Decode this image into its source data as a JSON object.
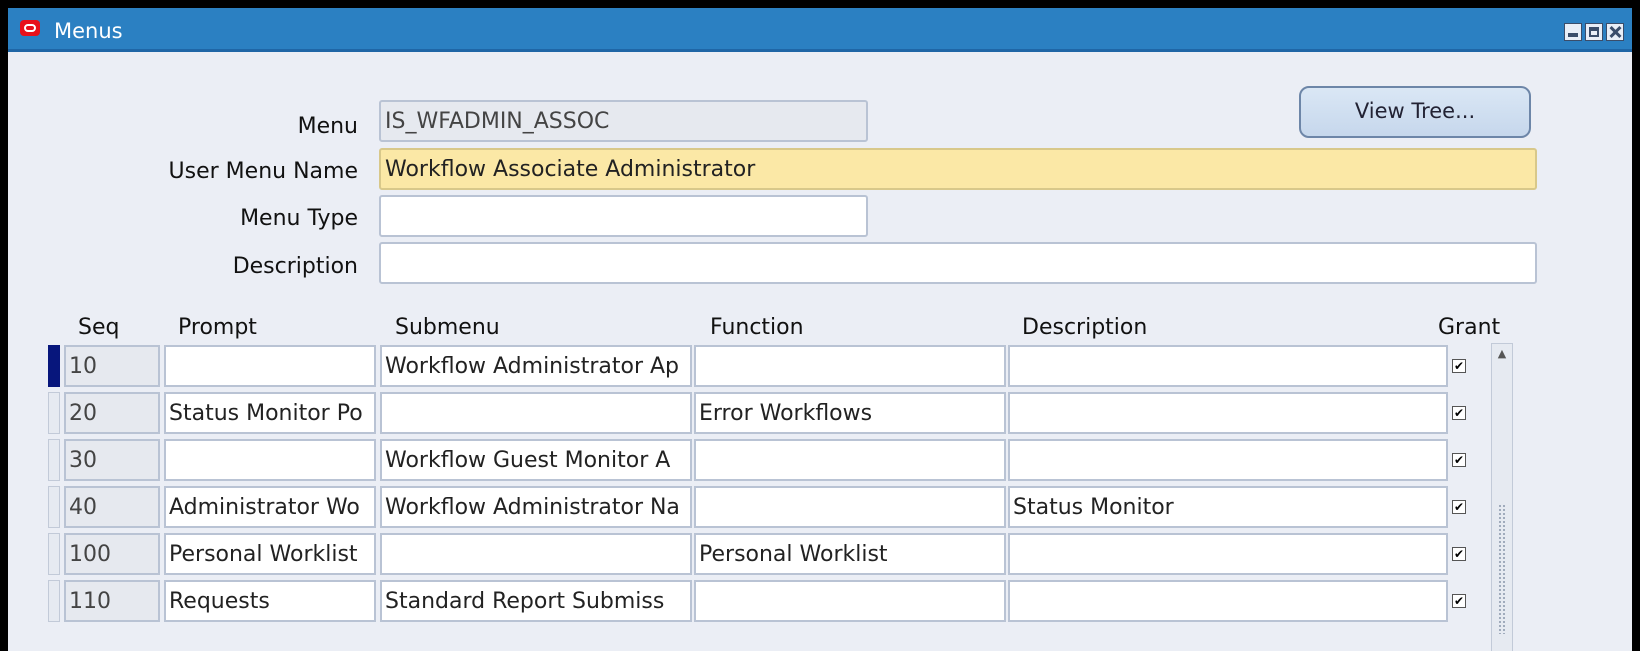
{
  "window": {
    "title": "Menus"
  },
  "header": {
    "menu_label": "Menu",
    "menu_value": "IS_WFADMIN_ASSOC",
    "user_menu_name_label": "User Menu Name",
    "user_menu_name_value": "Workflow Associate Administrator",
    "menu_type_label": "Menu Type",
    "menu_type_value": "",
    "description_label": "Description",
    "description_value": "",
    "view_tree_label": "View Tree..."
  },
  "grid": {
    "columns": [
      "Seq",
      "Prompt",
      "Submenu",
      "Function",
      "Description",
      "Grant"
    ],
    "rows": [
      {
        "seq": "10",
        "prompt": "",
        "submenu": "Workflow Administrator Ap",
        "function": "",
        "description": "",
        "grant": "✔"
      },
      {
        "seq": "20",
        "prompt": "Status Monitor Po",
        "submenu": "",
        "function": "Error Workflows",
        "description": "",
        "grant": "✔"
      },
      {
        "seq": "30",
        "prompt": "",
        "submenu": "Workflow Guest Monitor A",
        "function": "",
        "description": "",
        "grant": "✔"
      },
      {
        "seq": "40",
        "prompt": "Administrator Wo",
        "submenu": "Workflow Administrator Na",
        "function": "",
        "description": "Status Monitor",
        "grant": "✔"
      },
      {
        "seq": "100",
        "prompt": "Personal Worklist",
        "submenu": "",
        "function": "Personal  Worklist",
        "description": "",
        "grant": "✔"
      },
      {
        "seq": "110",
        "prompt": "Requests",
        "submenu": "Standard Report Submiss",
        "function": "",
        "description": "",
        "grant": "✔"
      }
    ]
  },
  "colors": {
    "titlebar": "#2b80c2",
    "required_field": "#fbe8a6",
    "current_row_marker": "#07167c"
  }
}
